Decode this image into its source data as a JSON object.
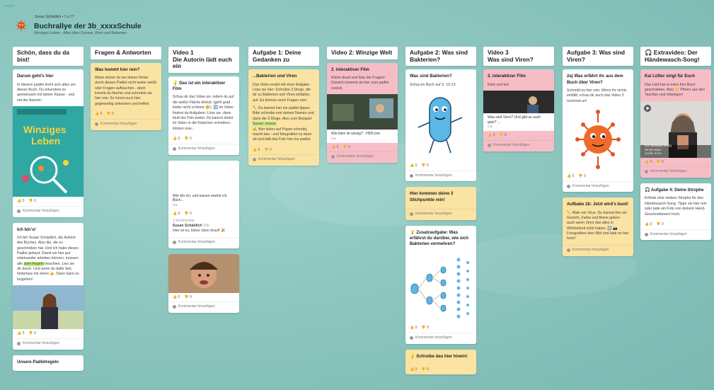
{
  "app_label": "padlet",
  "author_line": "Susan Schädlich • 1 a 77",
  "board": {
    "title": "Buchrallye der 3b_xxxxSchule",
    "subtitle": "Winziges Leben - Alles über Corona, Viren und Bakterien"
  },
  "reactions": "0",
  "add_comment": "Kommentar hinzufügen",
  "columns": [
    {
      "title": "Schön, dass du da bist!"
    },
    {
      "title": "Fragen & Antworten"
    },
    {
      "title": "Video 1\nDie Autorin lädt euch ein"
    },
    {
      "title": "Aufgabe 1: Deine Gedanken zu"
    },
    {
      "title": "Video 2: Winzige Welt"
    },
    {
      "title": "Aufgabe 2: Was sind Bakterien?"
    },
    {
      "title": "Video 3\nWas sind Viren?"
    },
    {
      "title": "Aufgabe 3: Was sind Viren?"
    },
    {
      "title": "🎧 Extravideo: Der Händewasch-Song!"
    }
  ],
  "cards": {
    "c1a": {
      "title": "Darum geht's hier",
      "text": "In diesem padlet dreht sich alles um dieses Buch. Du erkundest es gemeinsam mit deiner Klasse - und mit der Autorin!"
    },
    "c1b": {
      "title": "Ich bin's!",
      "text1": "Ich bin Susan Schädlich, die Autorin des Buches. Also die, die es geschrieben hat. Und ich habe dieses Padlet gebaut. Damit wir hier gut miteinander arbeiten können, müssen alle",
      "hl": "zwei Regeln",
      "text2": "beachten. Lies sie dir durch. Und wenn du dafür bist, hinterlass mir einen 👍. Dann kann es losgehen!"
    },
    "c1c": {
      "title": "Unsere Padletregeln"
    },
    "c2a": {
      "title": "Was kommt hier rein?",
      "text": "Wann immer du bei deiner Reise durch dieses Padlet nicht weiter weißt oder Fragen auftauchen - dann kommt du hierher und schreibst sie hier rein. Ihr könnt euch hier gegenseitig antworten und helfen."
    },
    "c3a": {
      "title": "💡 Das ist ein interaktiver Film",
      "text": "Schau dir das Video an, indem du auf die weiße Fläche klickst. (geht grad leider nicht schöner 😊). ➡️ Im Video findest du Aufgaben. Löse sie, dann läuft der Film weiter. Du kannst direkt im Video in die Kästchen schreiben, klicken usw..."
    },
    "c3b": {
      "cap": "Wer bin ich, und warum mache ich Büch...",
      "src": "h5p",
      "comments": "1 Kommentar",
      "cname": "Susan Schädlich",
      "ctime": "10h",
      "ctext": "Hier ist es, klicke oben drauf! 🎉"
    },
    "c4a": {
      "title": "...Bakterien und Viren",
      "text1": "Das Video endet mit einer Aufgabe. Löse sie hier: Schreibe 3 Dinge, die dir zu Bakterien und Viren einfallen, auf. Es können auch Fragen sein.",
      "text2": "✏️ Du kannst hier ins padlet tippen. Bitte schreibe erst deinen Namen und dann die 3 Dinge. Also zum Beispiel:",
      "hl": "Susan: xxxxxx",
      "text3": "✍️ Wer lieber auf Papier schreibt, macht das - und fotografiert es dann ab und lädt das Foto hier ins padlet."
    },
    "c5a": {
      "title": "2. interaktiver Film",
      "text": "Klicke drauf und löse die Fragen! Danach kommst du hier zum padlet zurück.",
      "cap": "Wie klein ist winzig? - H5P.com",
      "src": "h5p"
    },
    "c6a": {
      "title": "Was sind Bakterien?",
      "text": "Schau im Buch auf S. 10-13."
    },
    "c6b": {
      "title": "Hier kommen deine 3 Stichpunkte rein!"
    },
    "c6c": {
      "title": "💡 Zusatzaufgabe: Was erfährst du darüber, wie sich Bakterien vermehren?"
    },
    "c6d": {
      "title": "💡 Schreibe das hier hinein!"
    },
    "c7a": {
      "title": "3. interaktiver Film",
      "text": "Klick und los!",
      "cap": "Was sind Viren? Und gibt es auch gute? ...",
      "src": "h5p"
    },
    "c8a": {
      "title": "2a) Was erfährt ihr aus dem Buch über Viren?",
      "text": "Schreibt es hier rein. Wenn ihr nichts einfällt, schau dir auch das Video 3 nochmal an!"
    },
    "c8b": {
      "title": "Aufbabe 2b: Jetzt wird's bunt!",
      "text": "✏️ Male ein Virus. Du kannst ihm ein Gesicht, Farbe und Beine geben - auch wenn Viren das alles in Wirklichkeit nicht haben. ➡️ 📷 Fotografiere dein Bild und lade es hier hoch!"
    },
    "c9a": {
      "title": "Kai Lüfter singt für Euch",
      "text": "Das Lied hat er extra fürs Buch geschrieben. Also 👏 Pfoten aus den Taschen und mitsingen!",
      "vcap": "Hä ndewaschsong",
      "vsub": "00:59 video",
      "vsrc": "padlet drive"
    },
    "c9b": {
      "title": "🎧 Aufgabe 4: Deine Strophe",
      "text": "Erfinde eine weitere Strophe für den Händewasch-Song. Tippe sie hier rein oder lade ein Foto von deinem Hand-Geschriebenem hoch."
    }
  },
  "colors": {
    "yellow": "#fbe3a3",
    "pink": "#f7bdc6",
    "white": "#ffffff",
    "bg": "#8cc6bf"
  }
}
